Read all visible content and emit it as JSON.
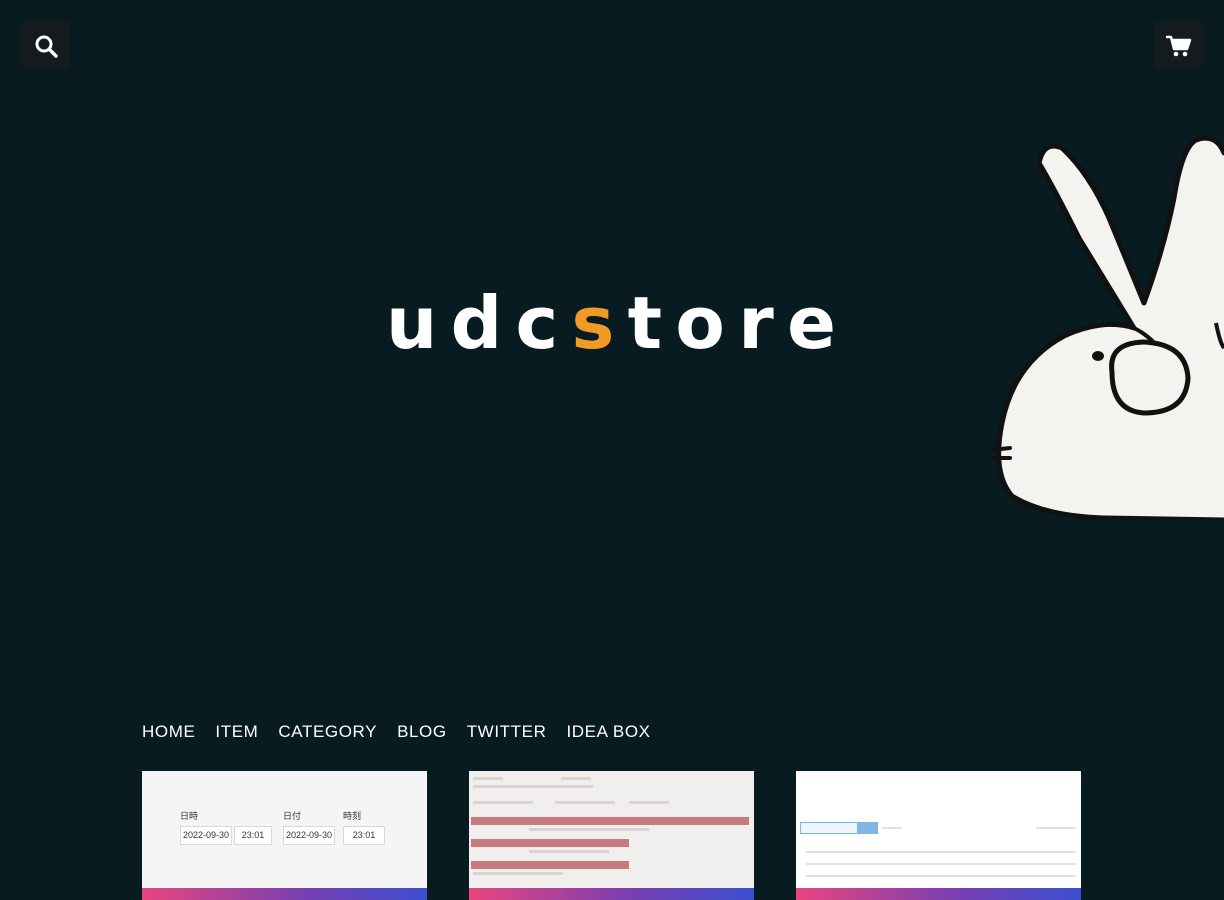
{
  "header": {
    "search_icon": "search-icon",
    "cart_icon": "cart-icon"
  },
  "logo": {
    "letters": [
      "u",
      "d",
      "c",
      "s",
      "t",
      "o",
      "r",
      "e"
    ],
    "accent_index": 3,
    "color": "#ffffff",
    "accent_color": "#f39a24"
  },
  "nav": {
    "items": [
      "HOME",
      "ITEM",
      "CATEGORY",
      "BLOG",
      "TWITTER",
      "IDEA BOX"
    ]
  },
  "cards": {
    "card1": {
      "label_datetime": "日時",
      "label_date": "日付",
      "label_time": "時刻",
      "value_date_1": "2022-09-30",
      "value_time_1": "23:01",
      "value_date_2": "2022-09-30",
      "value_time_2": "23:01"
    }
  },
  "colors": {
    "background": "#071b21",
    "icon_button": "#141b1e",
    "accent": "#f39a24"
  }
}
